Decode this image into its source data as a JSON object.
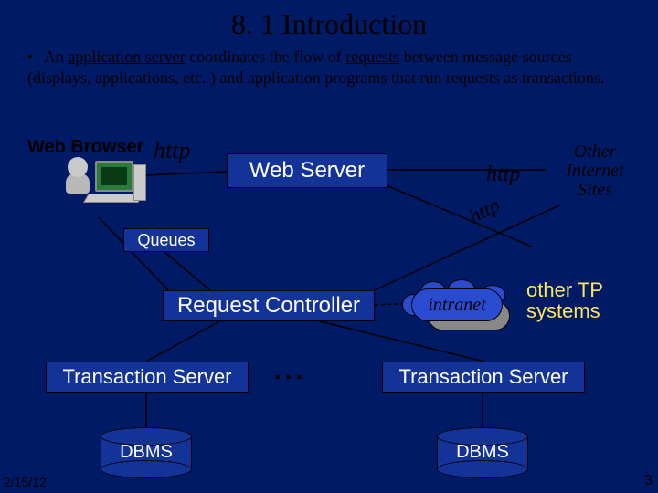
{
  "title": "8. 1 Introduction",
  "bullet": {
    "seg1": "An ",
    "underlined1": "application server",
    "seg2": " coordinates the flow of ",
    "underlined2": "requests",
    "seg3": " between message sources (displays, applications, etc. ) and application programs that run requests as transactions."
  },
  "labels": {
    "web_browser": "Web Browser",
    "http_left": "http",
    "http_right": "http",
    "http_diag": "http",
    "other_sites_l1": "Other",
    "other_sites_l2": "Internet",
    "other_sites_l3": "Sites",
    "queues": "Queues",
    "web_server": "Web Server",
    "req_ctrl": "Request Controller",
    "tserver": "Transaction Server",
    "ellipsis": "...",
    "intranet": "intranet",
    "other_tp_l1": "other TP",
    "other_tp_l2": "systems",
    "dbms": "DBMS"
  },
  "footer": {
    "date": "2/15/12",
    "page": "3"
  }
}
